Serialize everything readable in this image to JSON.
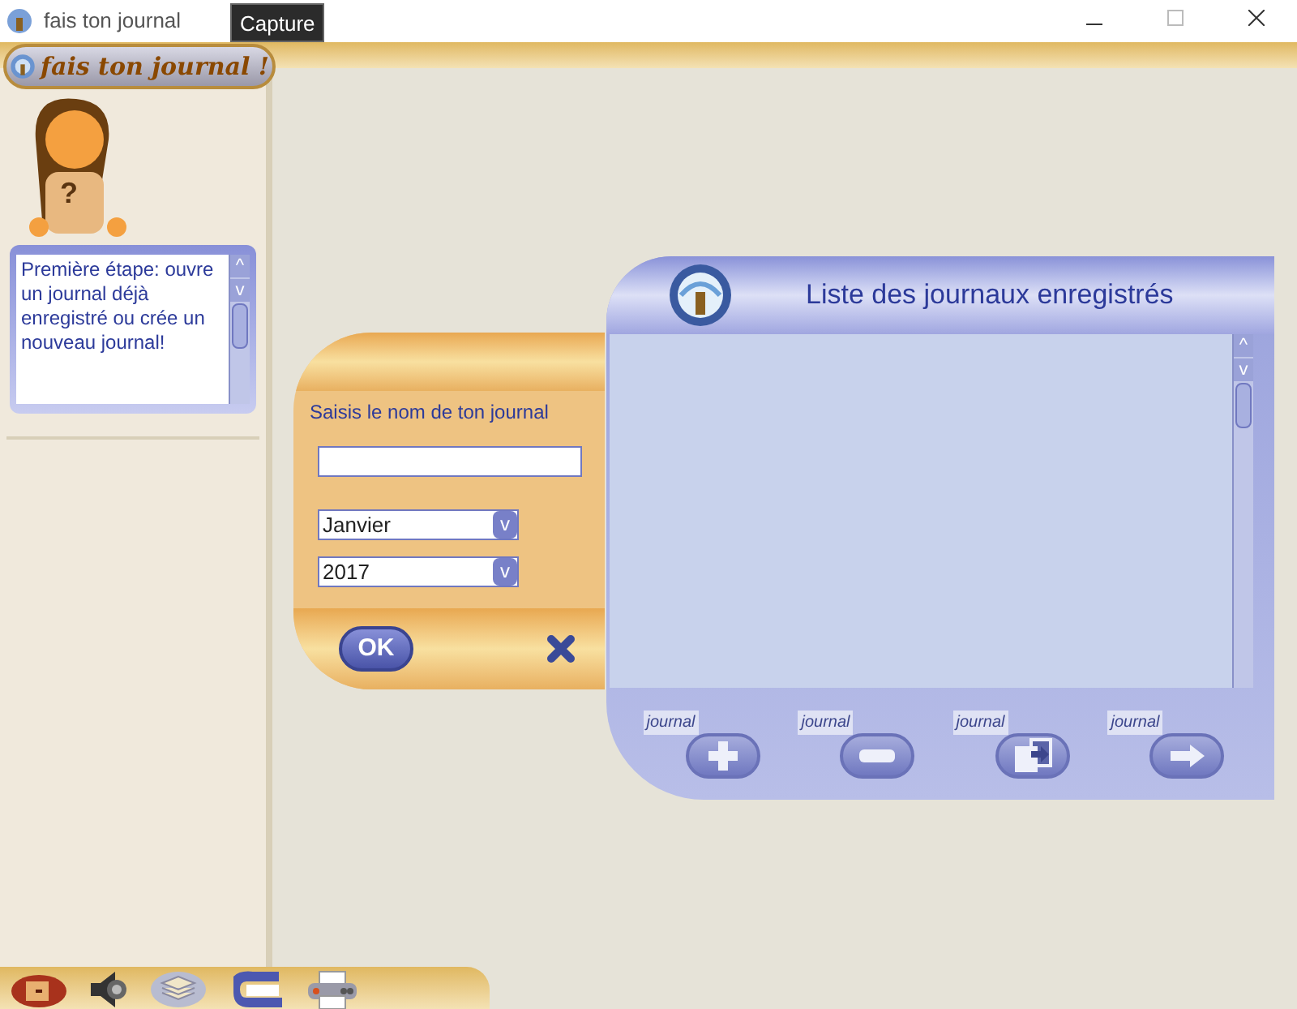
{
  "window": {
    "title": "fais ton journal",
    "tooltip": "Capture"
  },
  "logo": {
    "text": "fais ton journal !"
  },
  "mascot": {
    "badge": "?"
  },
  "help": {
    "text": "Première étape: ouvre un journal déjà enregistré ou crée un nouveau journal!",
    "scroll_up": "^",
    "scroll_down": "v"
  },
  "new_journal": {
    "label": "Saisis le nom de ton journal",
    "dropdowns": [
      {
        "value": "Janvier",
        "glyph": "v"
      },
      {
        "value": "2017",
        "glyph": "v"
      }
    ],
    "ok": "OK"
  },
  "saved_list": {
    "title": "Liste des journaux enregistrés",
    "scroll_up": "^",
    "scroll_down": "v",
    "actions": [
      {
        "kind": "add",
        "tag": "journal"
      },
      {
        "kind": "remove",
        "tag": "journal"
      },
      {
        "kind": "export",
        "tag": "journal"
      },
      {
        "kind": "open",
        "tag": "journal"
      }
    ]
  },
  "toolbar": [
    {
      "kind": "exit"
    },
    {
      "kind": "sound"
    },
    {
      "kind": "layers"
    },
    {
      "kind": "book"
    },
    {
      "kind": "print"
    }
  ]
}
